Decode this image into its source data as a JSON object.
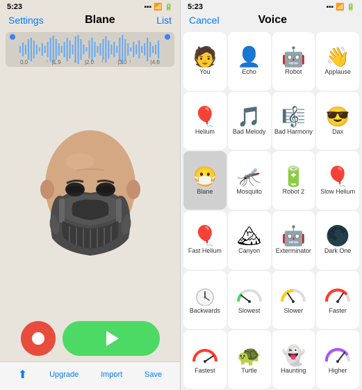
{
  "left": {
    "status_time": "5:23",
    "nav_settings": "Settings",
    "nav_title": "Blane",
    "nav_list": "List",
    "waveform_labels": [
      "0.0",
      "1.9",
      "2.0",
      "3.0",
      "4.0"
    ],
    "controls": {
      "record": "record",
      "play": "play"
    },
    "bottom_toolbar": [
      {
        "label": "Share",
        "icon": "⬆"
      },
      {
        "label": "Upgrade",
        "icon": ""
      },
      {
        "label": "Import",
        "icon": ""
      },
      {
        "label": "Save",
        "icon": ""
      }
    ]
  },
  "right": {
    "status_time": "5:23",
    "nav_cancel": "Cancel",
    "nav_title": "Voice",
    "voices": [
      {
        "label": "You",
        "icon": "👤",
        "selected": false
      },
      {
        "label": "Echo",
        "icon": "👤",
        "selected": false
      },
      {
        "label": "Robot",
        "icon": "🤖",
        "selected": false
      },
      {
        "label": "Applause",
        "icon": "👋",
        "selected": false
      },
      {
        "label": "Helium",
        "icon": "🎈",
        "selected": false
      },
      {
        "label": "Bad Melody",
        "icon": "🎵",
        "selected": false
      },
      {
        "label": "Bad Harmony",
        "icon": "🎼",
        "selected": false
      },
      {
        "label": "Dax",
        "icon": "😎",
        "selected": false
      },
      {
        "label": "Blane",
        "icon": "😷",
        "selected": true
      },
      {
        "label": "Mosquito",
        "icon": "🦟",
        "selected": false
      },
      {
        "label": "Robot 2",
        "icon": "🔋",
        "selected": false
      },
      {
        "label": "Slow Helium",
        "icon": "🎈",
        "selected": false
      },
      {
        "label": "Fast Helium",
        "icon": "🎈",
        "selected": false
      },
      {
        "label": "Canyon",
        "icon": "🏔",
        "selected": false
      },
      {
        "label": "Exterminator",
        "icon": "🤖",
        "selected": false
      },
      {
        "label": "Dark One",
        "icon": "🖤",
        "selected": false
      }
    ],
    "gauges": [
      {
        "label": "Backwards",
        "type": "clock",
        "color": "#888"
      },
      {
        "label": "Slowest",
        "type": "gauge",
        "color": "#4cd964",
        "pct": 10
      },
      {
        "label": "Slower",
        "type": "gauge",
        "color": "#ffcc00",
        "pct": 35
      },
      {
        "label": "Faster",
        "type": "gauge",
        "color": "#ff3b30",
        "pct": 75
      },
      {
        "label": "Fastest",
        "type": "gauge",
        "color": "#ff3b30",
        "pct": 90
      },
      {
        "label": "Turtle",
        "icon": "🐢",
        "selected": false
      },
      {
        "label": "Haunting",
        "icon": "👻",
        "selected": false
      },
      {
        "label": "Higher",
        "type": "gauge-purple",
        "color": "#a855f7",
        "pct": 85
      }
    ]
  }
}
